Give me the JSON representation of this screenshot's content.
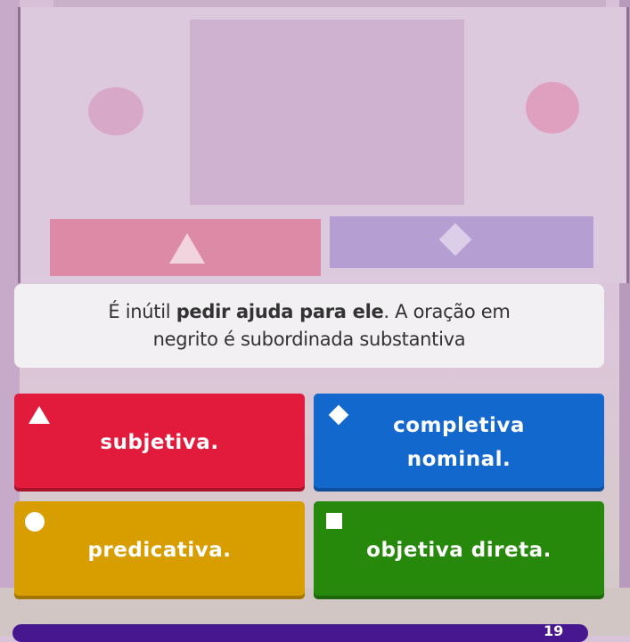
{
  "question": {
    "prefix": "É inútil ",
    "bold": "pedir ajuda para ele",
    "suffix": ". A oração em negrito é subordinada substantiva"
  },
  "answers": [
    {
      "label": "subjetiva.",
      "color": "#e21b3c",
      "icon": "triangle-icon"
    },
    {
      "label": "completiva\nnominal.",
      "color": "#1368ce",
      "icon": "diamond-icon"
    },
    {
      "label": "predicativa.",
      "color": "#d89e00",
      "icon": "circle-icon"
    },
    {
      "label": "objetiva direta.",
      "color": "#26890c",
      "icon": "square-icon"
    }
  ],
  "progress": {
    "label": "19",
    "color": "#46178f"
  }
}
